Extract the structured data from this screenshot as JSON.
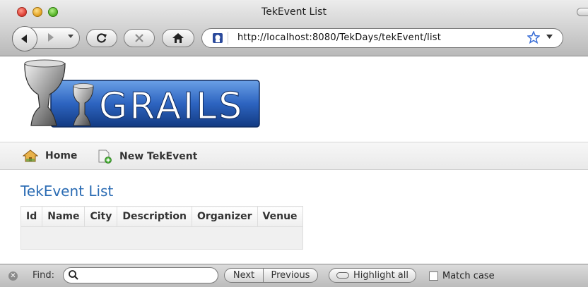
{
  "window": {
    "title": "TekEvent List"
  },
  "toolbar": {
    "url": "http://localhost:8080/TekDays/tekEvent/list"
  },
  "page": {
    "nav": {
      "home_label": "Home",
      "new_label": "New TekEvent"
    },
    "title": "TekEvent List",
    "table": {
      "headers": [
        "Id",
        "Name",
        "City",
        "Description",
        "Organizer",
        "Venue"
      ],
      "rows": []
    }
  },
  "findbar": {
    "label": "Find:",
    "value": "",
    "next_label": "Next",
    "previous_label": "Previous",
    "highlight_label": "Highlight all",
    "match_case_label": "Match case"
  },
  "icons": {
    "window_close": "close-icon",
    "window_minimize": "minimize-icon",
    "window_zoom": "zoom-icon",
    "back": "back-arrow-icon",
    "forward": "forward-arrow-icon",
    "history": "history-dropdown-icon",
    "reload": "reload-icon",
    "stop": "stop-icon",
    "home": "home-icon",
    "site": "site-identity-icon",
    "bookmark": "star-icon",
    "nav_home": "home-icon",
    "nav_new": "new-document-icon",
    "find_close": "close-icon",
    "find_search": "search-icon"
  },
  "colors": {
    "title_blue": "#2a6bb3",
    "bookmark_blue": "#3b6fd6"
  },
  "logo": {
    "text": "GRAILS"
  }
}
